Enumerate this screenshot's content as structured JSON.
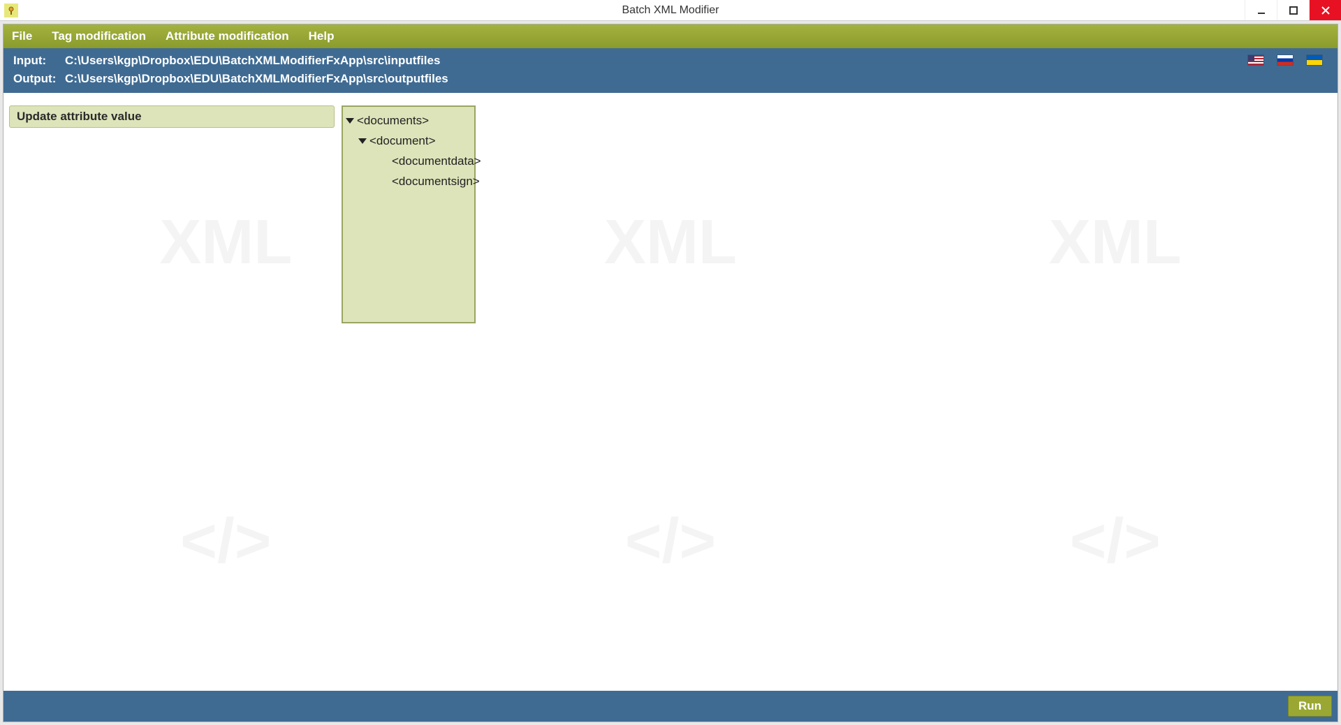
{
  "window": {
    "title": "Batch XML Modifier"
  },
  "menu": {
    "items": [
      "File",
      "Tag modification",
      "Attribute modification",
      "Help"
    ]
  },
  "paths": {
    "input_label": "Input:",
    "input_value": "C:\\Users\\kgp\\Dropbox\\EDU\\BatchXMLModifierFxApp\\src\\inputfiles",
    "output_label": "Output:",
    "output_value": "C:\\Users\\kgp\\Dropbox\\EDU\\BatchXMLModifierFxApp\\src\\outputfiles"
  },
  "flags": [
    "us",
    "ru",
    "ua"
  ],
  "left_panel": {
    "header": "Update attribute value"
  },
  "tree": {
    "nodes": [
      {
        "level": 0,
        "expanded": true,
        "label": "<documents>"
      },
      {
        "level": 1,
        "expanded": true,
        "label": "<document>"
      },
      {
        "level": 2,
        "expanded": false,
        "label": "<documentdata>"
      },
      {
        "level": 2,
        "expanded": false,
        "label": "<documentsign>"
      }
    ]
  },
  "footer": {
    "run_label": "Run"
  },
  "watermark_text": "XML"
}
